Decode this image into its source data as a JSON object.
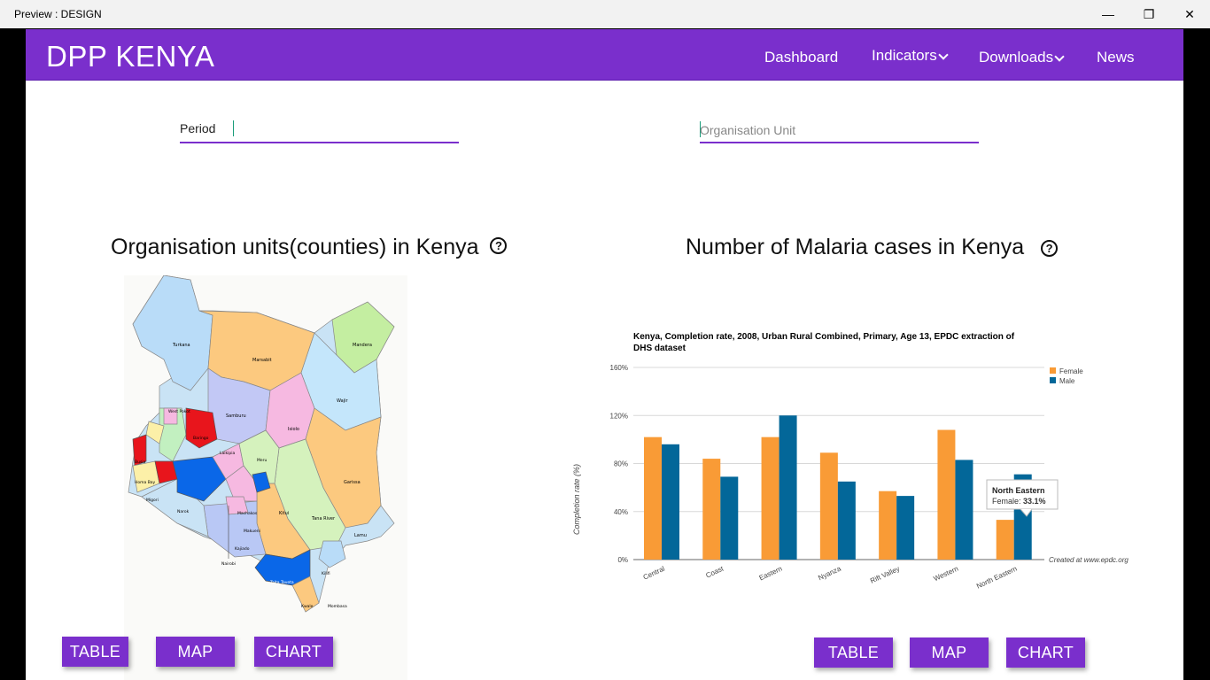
{
  "window": {
    "title": "Preview : DESIGN",
    "minimize": "—",
    "restore": "❐",
    "close": "✕"
  },
  "navbar": {
    "brand": "DPP KENYA",
    "items": [
      {
        "label": "Dashboard",
        "dropdown": false
      },
      {
        "label": "Indicators",
        "dropdown": true
      },
      {
        "label": "Downloads",
        "dropdown": true
      },
      {
        "label": "News",
        "dropdown": false
      }
    ]
  },
  "filters": {
    "period": {
      "label": "Period",
      "value": ""
    },
    "org_unit": {
      "placeholder": "Organisation Unit",
      "value": ""
    }
  },
  "left_panel": {
    "title": "Organisation units(counties) in Kenya",
    "help_icon": "?",
    "buttons": [
      "TABLE",
      "MAP",
      "CHART"
    ],
    "map_labels": [
      "Turkana",
      "Marsabit",
      "Mandera",
      "Wajir",
      "Samburu",
      "West Pokot",
      "Isiolo",
      "Baringo",
      "Laikipia",
      "Meru",
      "Garissa",
      "Kitui",
      "Tana River",
      "Lamu",
      "Machakos",
      "Makueni",
      "Kajiado",
      "Nairobi",
      "Narok",
      "Taita Taveta",
      "Kilifi",
      "Kwale",
      "Mombasa",
      "Busia",
      "Migori",
      "Homa Bay"
    ]
  },
  "right_panel": {
    "title": "Number of Malaria cases in Kenya",
    "help_icon": "?",
    "buttons": [
      "TABLE",
      "MAP",
      "CHART"
    ]
  },
  "colors": {
    "accent": "#7a2fcc",
    "female": "#f99b36",
    "male": "#036799",
    "red": "#e8151c",
    "blue": "#0a67e8"
  },
  "chart_data": {
    "type": "bar",
    "title": "Kenya, Completion rate, 2008, Urban Rural Combined, Primary, Age 13, EPDC extraction of DHS dataset",
    "title_line1": "Kenya, Completion rate, 2008, Urban Rural Combined, Primary, Age 13, EPDC extraction of",
    "title_line2": "DHS dataset",
    "ylabel": "Completion rate (%)",
    "xlabel": "",
    "ylim": [
      0,
      160
    ],
    "yticks": [
      "0%",
      "40%",
      "80%",
      "120%",
      "160%"
    ],
    "ytick_values": [
      0,
      40,
      80,
      120,
      160
    ],
    "categories": [
      "Central",
      "Coast",
      "Eastern",
      "Nyanza",
      "Rift Valley",
      "Western",
      "North Eastern"
    ],
    "series": [
      {
        "name": "Female",
        "values": [
          102,
          84,
          102,
          89,
          57,
          108,
          33.1
        ]
      },
      {
        "name": "Male",
        "values": [
          96,
          69,
          120,
          65,
          53,
          83,
          71
        ]
      }
    ],
    "legend_position": "top-right",
    "grid": true,
    "credit": "Created at www.epdc.org",
    "tooltip": {
      "title": "North Eastern",
      "label": "Female:",
      "value": "33.1%"
    }
  }
}
